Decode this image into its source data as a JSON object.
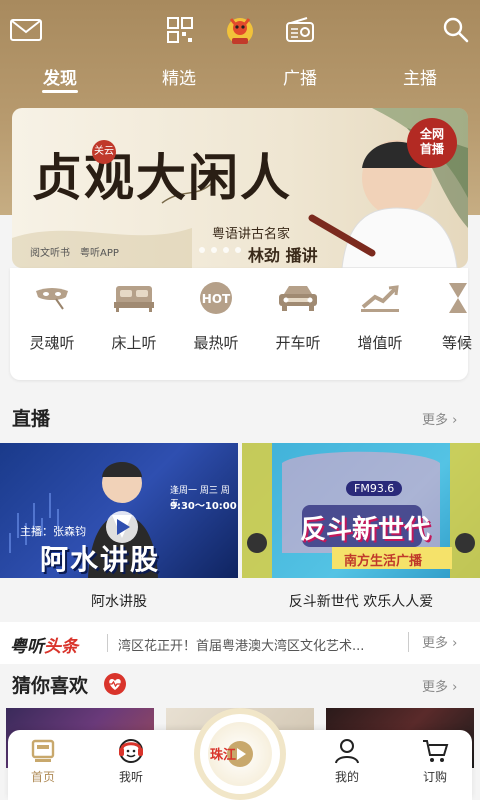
{
  "header": {
    "tabs": [
      {
        "label": "发现",
        "active": true
      },
      {
        "label": "精选",
        "active": false
      },
      {
        "label": "广播",
        "active": false
      },
      {
        "label": "主播",
        "active": false
      }
    ],
    "icons": [
      "mail-icon",
      "scan-grid-icon",
      "mascot-logo-icon",
      "radio-icon",
      "search-icon"
    ]
  },
  "banner": {
    "title": "贞观大闲人",
    "subtitle": "粤语讲古名家",
    "host": "林劲 播讲",
    "seal": "关云",
    "badge_line1": "全网",
    "badge_line2": "首播",
    "brand1": "阅文听书",
    "brand2": "粤听APP"
  },
  "categories": [
    {
      "label": "灵魂听",
      "icon": "mask-icon"
    },
    {
      "label": "床上听",
      "icon": "bed-icon"
    },
    {
      "label": "最热听",
      "icon": "hot-icon"
    },
    {
      "label": "开车听",
      "icon": "car-icon"
    },
    {
      "label": "增值听",
      "icon": "trend-icon"
    },
    {
      "label": "等候",
      "icon": "hourglass-icon"
    }
  ],
  "live": {
    "title": "直播",
    "more": "更多",
    "items": [
      {
        "caption": "阿水讲股",
        "art_text": "阿水讲股",
        "host": "主播：张森钧",
        "schedule": "逢周一 周三 周五",
        "time": "9:30～10:00"
      },
      {
        "caption": "反斗新世代 欢乐人人爱",
        "art_text": "反斗新世代",
        "badge": "FM93.6",
        "station": "南方生活广播"
      }
    ]
  },
  "news": {
    "brand_a": "粤听",
    "brand_b": "头条",
    "headline": "湾区花正开！首届粤港澳大湾区文化艺术...",
    "more": "更多"
  },
  "guess": {
    "title": "猜你喜欢",
    "more": "更多"
  },
  "bottom_nav": [
    {
      "label": "首页",
      "icon": "home-icon",
      "active": true
    },
    {
      "label": "我听",
      "icon": "listen-icon",
      "active": false
    },
    {
      "label": "",
      "icon": "center-play-icon",
      "active": false
    },
    {
      "label": "我的",
      "icon": "user-icon",
      "active": false
    },
    {
      "label": "订购",
      "icon": "cart-icon",
      "active": false
    }
  ],
  "center_logo": "珠江",
  "colors": {
    "accent": "#b08c58",
    "hot": "#d9342b"
  }
}
